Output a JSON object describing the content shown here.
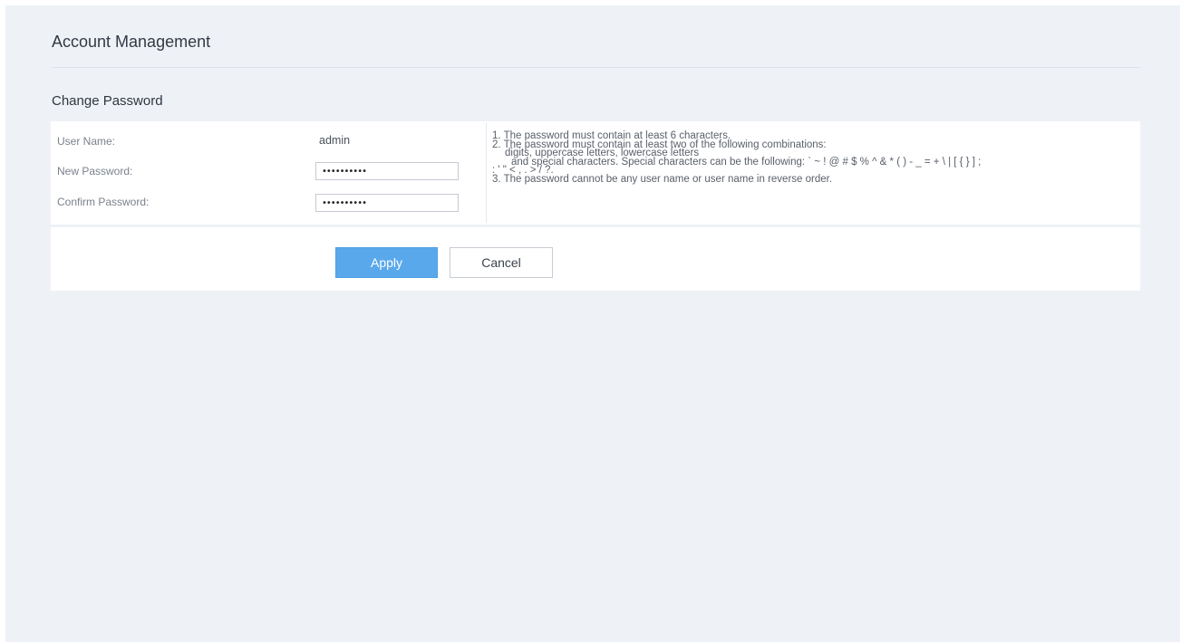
{
  "header": {
    "title": "Account Management"
  },
  "section": {
    "title": "Change Password"
  },
  "form": {
    "username_label": "User Name:",
    "username_value": "admin",
    "new_password_label": "New Password:",
    "new_password_value": "••••••••••",
    "confirm_password_label": "Confirm Password:",
    "confirm_password_value": "••••••••••"
  },
  "rules": [
    "1. The password must contain at least 6 characters.",
    "2. The password must contain at least two of the following combinations:",
    "digits, uppercase letters, lowercase letters",
    "and special characters. Special characters can be the following: ` ~ ! @ # $ % ^ & * ( ) - _ = + \\ | [ { } ] ;",
    ": ' \" < , . > / ?.",
    "3. The password cannot be any user name or user name in reverse order."
  ],
  "actions": {
    "apply_label": "Apply",
    "cancel_label": "Cancel"
  },
  "colors": {
    "background": "#eef1f6",
    "panel": "#ffffff",
    "primary_button": "#5aa8ec"
  }
}
